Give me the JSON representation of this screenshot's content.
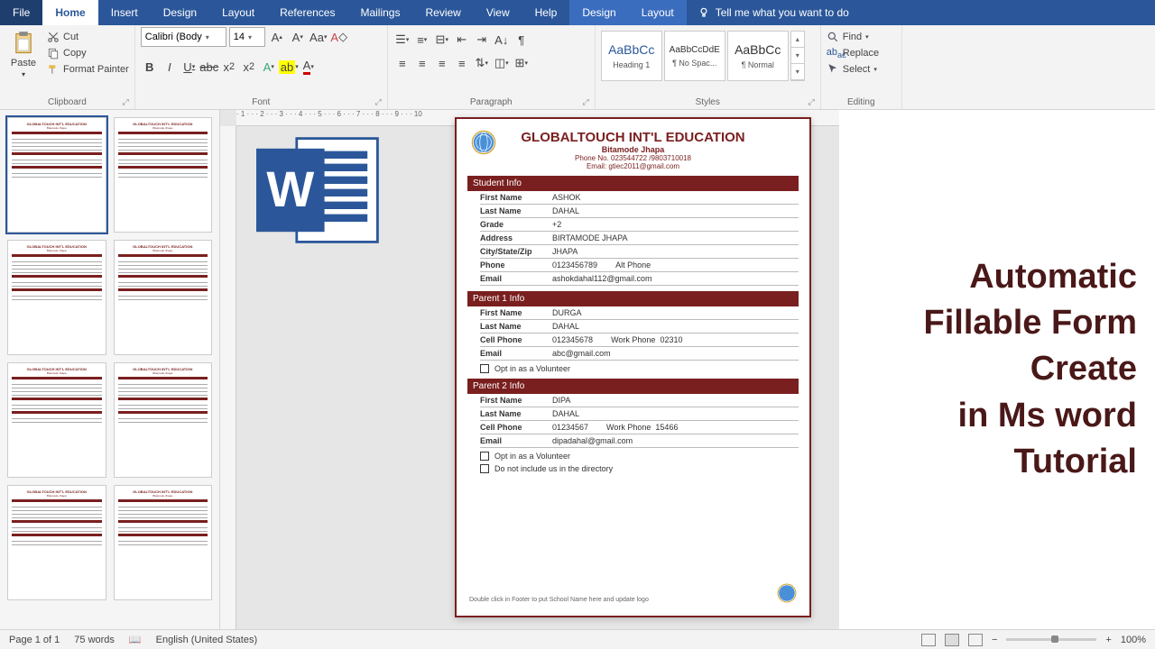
{
  "ribbon": {
    "tabs": [
      "File",
      "Home",
      "Insert",
      "Design",
      "Layout",
      "References",
      "Mailings",
      "Review",
      "View",
      "Help",
      "Design",
      "Layout"
    ],
    "active": 1,
    "tell_me": "Tell me what you want to do",
    "clipboard": {
      "label": "Clipboard",
      "paste": "Paste",
      "cut": "Cut",
      "copy": "Copy",
      "painter": "Format Painter"
    },
    "font": {
      "label": "Font",
      "name": "Calibri (Body",
      "size": "14"
    },
    "paragraph": {
      "label": "Paragraph"
    },
    "styles": {
      "label": "Styles",
      "items": [
        {
          "preview": "AaBbCc",
          "name": "Heading 1"
        },
        {
          "preview": "AaBbCcDdE",
          "name": "¶ No Spac..."
        },
        {
          "preview": "AaBbCc",
          "name": "¶ Normal"
        }
      ]
    },
    "editing": {
      "label": "Editing",
      "find": "Find",
      "replace": "Replace",
      "select": "Select"
    }
  },
  "doc": {
    "org_title": "GLOBALTOUCH INT'L EDUCATION",
    "org_sub": "Bitamode Jhapa",
    "org_phone": "Phone No. 023544722 /9803710018",
    "org_email": "Email: gtiec2011@gmail.com",
    "sections": {
      "student": {
        "title": "Student Info",
        "fields": {
          "first_name": {
            "label": "First Name",
            "val": "ASHOK"
          },
          "last_name": {
            "label": "Last Name",
            "val": "DAHAL"
          },
          "grade": {
            "label": "Grade",
            "val": "+2"
          },
          "address": {
            "label": "Address",
            "val": "BIRTAMODE JHAPA"
          },
          "city": {
            "label": "City/State/Zip",
            "val": "JHAPA"
          },
          "phone": {
            "label": "Phone",
            "val": "0123456789",
            "extra_label": "Alt Phone",
            "extra_val": ""
          },
          "email": {
            "label": "Email",
            "val": "ashokdahal112@gmail.com"
          }
        }
      },
      "parent1": {
        "title": "Parent 1 Info",
        "fields": {
          "first_name": {
            "label": "First Name",
            "val": "DURGA"
          },
          "last_name": {
            "label": "Last Name",
            "val": "DAHAL"
          },
          "cell": {
            "label": "Cell Phone",
            "val": "012345678",
            "extra_label": "Work Phone",
            "extra_val": "02310"
          },
          "email": {
            "label": "Email",
            "val": "abc@gmail.com"
          }
        },
        "opt": "Opt in as a Volunteer"
      },
      "parent2": {
        "title": "Parent 2 Info",
        "fields": {
          "first_name": {
            "label": "First Name",
            "val": "DIPA"
          },
          "last_name": {
            "label": "Last Name",
            "val": "DAHAL"
          },
          "cell": {
            "label": "Cell Phone",
            "val": "01234567",
            "extra_label": "Work Phone",
            "extra_val": "15466"
          },
          "email": {
            "label": "Email",
            "val": "dipadahal@gmail.com"
          }
        },
        "opt": "Opt in as a Volunteer"
      }
    },
    "directory": "Do not include us in the directory",
    "footer": "Double click in Footer to put School Name here and update logo"
  },
  "promo": {
    "l1": "Automatic",
    "l2": "Fillable Form",
    "l3": "Create",
    "l4": "in Ms word",
    "l5": "Tutorial"
  },
  "status": {
    "page": "Page 1 of 1",
    "words": "75 words",
    "lang": "English (United States)",
    "zoom": "100%"
  }
}
